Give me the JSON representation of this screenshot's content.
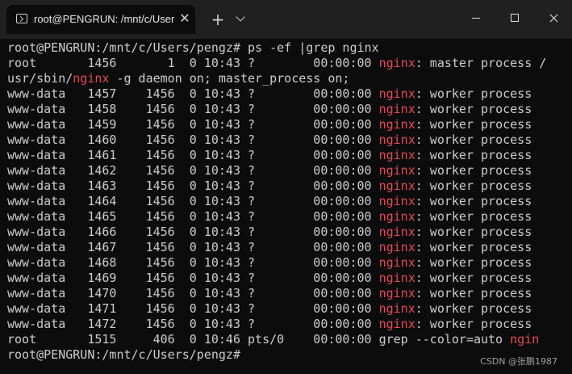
{
  "window": {
    "tab_title": "root@PENGRUN: /mnt/c/User",
    "tab_close_glyph": "✕",
    "new_tab_glyph": "+",
    "icons": {
      "terminal": "terminal-icon",
      "new_tab": "plus-icon",
      "dropdown": "chevron-down-icon",
      "minimize": "minimize-icon",
      "maximize": "maximize-icon",
      "close": "close-icon"
    }
  },
  "colors": {
    "background": "#0c0c0c",
    "titlebar": "#202020",
    "text": "#cccccc",
    "highlight": "#e74856"
  },
  "terminal": {
    "lines": [
      {
        "segments": [
          {
            "text": "root@PENGRUN:/mnt/c/Users/pengz# ps -ef |grep nginx",
            "color": "default"
          }
        ]
      },
      {
        "segments": [
          {
            "text": "root       1456       1  0 10:43 ?        00:00:00 ",
            "color": "default"
          },
          {
            "text": "nginx",
            "color": "highlight"
          },
          {
            "text": ": master process /",
            "color": "default"
          }
        ]
      },
      {
        "segments": [
          {
            "text": "usr/sbin/",
            "color": "default"
          },
          {
            "text": "nginx",
            "color": "highlight"
          },
          {
            "text": " -g daemon on; master_process on;",
            "color": "default"
          }
        ]
      },
      {
        "segments": [
          {
            "text": "www-data   1457    1456  0 10:43 ?        00:00:00 ",
            "color": "default"
          },
          {
            "text": "nginx",
            "color": "highlight"
          },
          {
            "text": ": worker process",
            "color": "default"
          }
        ]
      },
      {
        "segments": [
          {
            "text": "www-data   1458    1456  0 10:43 ?        00:00:00 ",
            "color": "default"
          },
          {
            "text": "nginx",
            "color": "highlight"
          },
          {
            "text": ": worker process",
            "color": "default"
          }
        ]
      },
      {
        "segments": [
          {
            "text": "www-data   1459    1456  0 10:43 ?        00:00:00 ",
            "color": "default"
          },
          {
            "text": "nginx",
            "color": "highlight"
          },
          {
            "text": ": worker process",
            "color": "default"
          }
        ]
      },
      {
        "segments": [
          {
            "text": "www-data   1460    1456  0 10:43 ?        00:00:00 ",
            "color": "default"
          },
          {
            "text": "nginx",
            "color": "highlight"
          },
          {
            "text": ": worker process",
            "color": "default"
          }
        ]
      },
      {
        "segments": [
          {
            "text": "www-data   1461    1456  0 10:43 ?        00:00:00 ",
            "color": "default"
          },
          {
            "text": "nginx",
            "color": "highlight"
          },
          {
            "text": ": worker process",
            "color": "default"
          }
        ]
      },
      {
        "segments": [
          {
            "text": "www-data   1462    1456  0 10:43 ?        00:00:00 ",
            "color": "default"
          },
          {
            "text": "nginx",
            "color": "highlight"
          },
          {
            "text": ": worker process",
            "color": "default"
          }
        ]
      },
      {
        "segments": [
          {
            "text": "www-data   1463    1456  0 10:43 ?        00:00:00 ",
            "color": "default"
          },
          {
            "text": "nginx",
            "color": "highlight"
          },
          {
            "text": ": worker process",
            "color": "default"
          }
        ]
      },
      {
        "segments": [
          {
            "text": "www-data   1464    1456  0 10:43 ?        00:00:00 ",
            "color": "default"
          },
          {
            "text": "nginx",
            "color": "highlight"
          },
          {
            "text": ": worker process",
            "color": "default"
          }
        ]
      },
      {
        "segments": [
          {
            "text": "www-data   1465    1456  0 10:43 ?        00:00:00 ",
            "color": "default"
          },
          {
            "text": "nginx",
            "color": "highlight"
          },
          {
            "text": ": worker process",
            "color": "default"
          }
        ]
      },
      {
        "segments": [
          {
            "text": "www-data   1466    1456  0 10:43 ?        00:00:00 ",
            "color": "default"
          },
          {
            "text": "nginx",
            "color": "highlight"
          },
          {
            "text": ": worker process",
            "color": "default"
          }
        ]
      },
      {
        "segments": [
          {
            "text": "www-data   1467    1456  0 10:43 ?        00:00:00 ",
            "color": "default"
          },
          {
            "text": "nginx",
            "color": "highlight"
          },
          {
            "text": ": worker process",
            "color": "default"
          }
        ]
      },
      {
        "segments": [
          {
            "text": "www-data   1468    1456  0 10:43 ?        00:00:00 ",
            "color": "default"
          },
          {
            "text": "nginx",
            "color": "highlight"
          },
          {
            "text": ": worker process",
            "color": "default"
          }
        ]
      },
      {
        "segments": [
          {
            "text": "www-data   1469    1456  0 10:43 ?        00:00:00 ",
            "color": "default"
          },
          {
            "text": "nginx",
            "color": "highlight"
          },
          {
            "text": ": worker process",
            "color": "default"
          }
        ]
      },
      {
        "segments": [
          {
            "text": "www-data   1470    1456  0 10:43 ?        00:00:00 ",
            "color": "default"
          },
          {
            "text": "nginx",
            "color": "highlight"
          },
          {
            "text": ": worker process",
            "color": "default"
          }
        ]
      },
      {
        "segments": [
          {
            "text": "www-data   1471    1456  0 10:43 ?        00:00:00 ",
            "color": "default"
          },
          {
            "text": "nginx",
            "color": "highlight"
          },
          {
            "text": ": worker process",
            "color": "default"
          }
        ]
      },
      {
        "segments": [
          {
            "text": "www-data   1472    1456  0 10:43 ?        00:00:00 ",
            "color": "default"
          },
          {
            "text": "nginx",
            "color": "highlight"
          },
          {
            "text": ": worker process",
            "color": "default"
          }
        ]
      },
      {
        "segments": [
          {
            "text": "root       1515     406  0 10:46 pts/0    00:00:00 grep --color=auto ",
            "color": "default"
          },
          {
            "text": "ngin",
            "color": "highlight"
          }
        ]
      },
      {
        "segments": [
          {
            "text": "root@PENGRUN:/mnt/c/Users/pengz#",
            "color": "default"
          }
        ]
      }
    ]
  },
  "watermark": "CSDN @张鹏1987"
}
